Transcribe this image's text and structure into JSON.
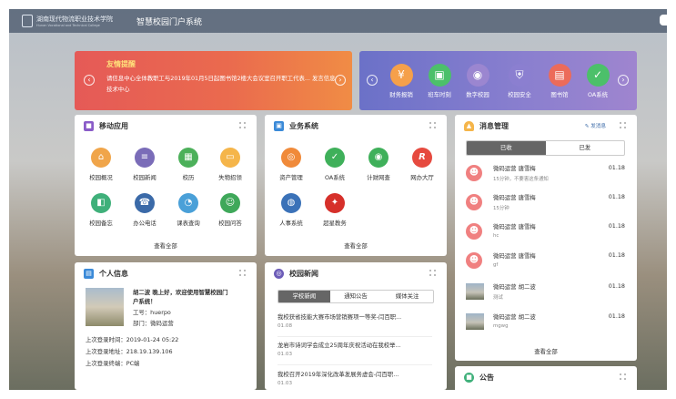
{
  "topbar": {
    "logo_text": "湖南现代物流职业技术学院",
    "logo_sub": "Hunan Vocational and Technical College",
    "portal_title": "智慧校园门户系统"
  },
  "banner": {
    "title": "友情提醒",
    "text": "请信息中心全体教职工与2019年01月5日起图书馆2楼大会议室召开职工代表大会发言信息技术中心",
    "text_visible": "请信息中心全体教职工与2019年01月5日起图书馆2楼大会议室召开职工代表... 发言信息技术中心"
  },
  "quicklinks": [
    {
      "label": "财务报销",
      "icon": "yen-icon",
      "color": "#f5a04a"
    },
    {
      "label": "班车时刻",
      "icon": "bus-icon",
      "color": "#4cc06a"
    },
    {
      "label": "数字校园",
      "icon": "signal-icon",
      "color": "#9b86d0"
    },
    {
      "label": "校园安全",
      "icon": "shield-icon",
      "color": "#8b7fd0"
    },
    {
      "label": "图书馆",
      "icon": "book-icon",
      "color": "#ec6b5a"
    },
    {
      "label": "OA系统",
      "icon": "check-icon",
      "color": "#4cc06a"
    }
  ],
  "mobile_apps": {
    "title": "移动应用",
    "items": [
      {
        "label": "校园概况",
        "color": "#f0a54a"
      },
      {
        "label": "校园新闻",
        "color": "#7a6cb8"
      },
      {
        "label": "校历",
        "color": "#4cb05a"
      },
      {
        "label": "失物招领",
        "color": "#f5b54a"
      },
      {
        "label": "校园备忘",
        "color": "#3fb07a"
      },
      {
        "label": "办公电话",
        "color": "#3b6aa8"
      },
      {
        "label": "课表查询",
        "color": "#4aa0d8"
      },
      {
        "label": "校园问答",
        "color": "#3fa85a"
      }
    ],
    "more": "查看全部"
  },
  "business": {
    "title": "业务系统",
    "items": [
      {
        "label": "资产管理",
        "color": "#f08a3a"
      },
      {
        "label": "OA系统",
        "color": "#3fb05a"
      },
      {
        "label": "计财网查",
        "color": "#3fb05a"
      },
      {
        "label": "网办大厅",
        "color": "#e64a3f"
      },
      {
        "label": "人事系统",
        "color": "#3b72b8"
      },
      {
        "label": "超星教务",
        "color": "#d6302a"
      }
    ],
    "more": "查看全部"
  },
  "messages": {
    "title": "消息管理",
    "publish": "发消息",
    "tabs": [
      "已收",
      "已发"
    ],
    "items": [
      {
        "name": "微码运营 唐雪梅",
        "sub": "15分钟，不要害这条通知",
        "date": "01.18",
        "avatar": "person"
      },
      {
        "name": "微码运营 唐雪梅",
        "sub": "15分钟",
        "date": "01.18",
        "avatar": "person"
      },
      {
        "name": "微码运营 唐雪梅",
        "sub": "hc",
        "date": "01.18",
        "avatar": "person"
      },
      {
        "name": "微码运营 唐雪梅",
        "sub": "gf",
        "date": "01.18",
        "avatar": "person"
      },
      {
        "name": "微码运营 胡二波",
        "sub": "测试",
        "date": "01.18",
        "avatar": "photo"
      },
      {
        "name": "微码运营 胡二波",
        "sub": "mgwg",
        "date": "01.18",
        "avatar": "photo"
      }
    ],
    "more": "查看全部"
  },
  "profile": {
    "title": "个人信息",
    "greeting": "胡二波 晚上好，欢迎使用智慧校园门户系统！",
    "greeting_l1": "胡二波 晚上好，欢迎使用智慧校园门",
    "greeting_l2": "户系统！",
    "id_line": "工号：huerpo",
    "dept_line": "部门：微码运营",
    "last_login_time": "上次登录时间：2019-01-24 05:22",
    "last_login_addr": "上次登录地址：218.19.139.106",
    "last_login_device": "上次登录终端：PC端"
  },
  "news": {
    "title": "校园新闻",
    "tabs": [
      "学校新闻",
      "通知公告",
      "媒体关注"
    ],
    "items": [
      {
        "title": "我校获省技能大赛市场营销赛项一等奖-闫百职...",
        "date": "01.08"
      },
      {
        "title": "龙岩市诗词学会成立25周年庆祝活动在我校举...",
        "date": "01.03"
      },
      {
        "title": "我校召开2019年深化改革发展务虚会-闫百职...",
        "date": "01.03"
      }
    ]
  },
  "notice": {
    "title": "公告"
  }
}
